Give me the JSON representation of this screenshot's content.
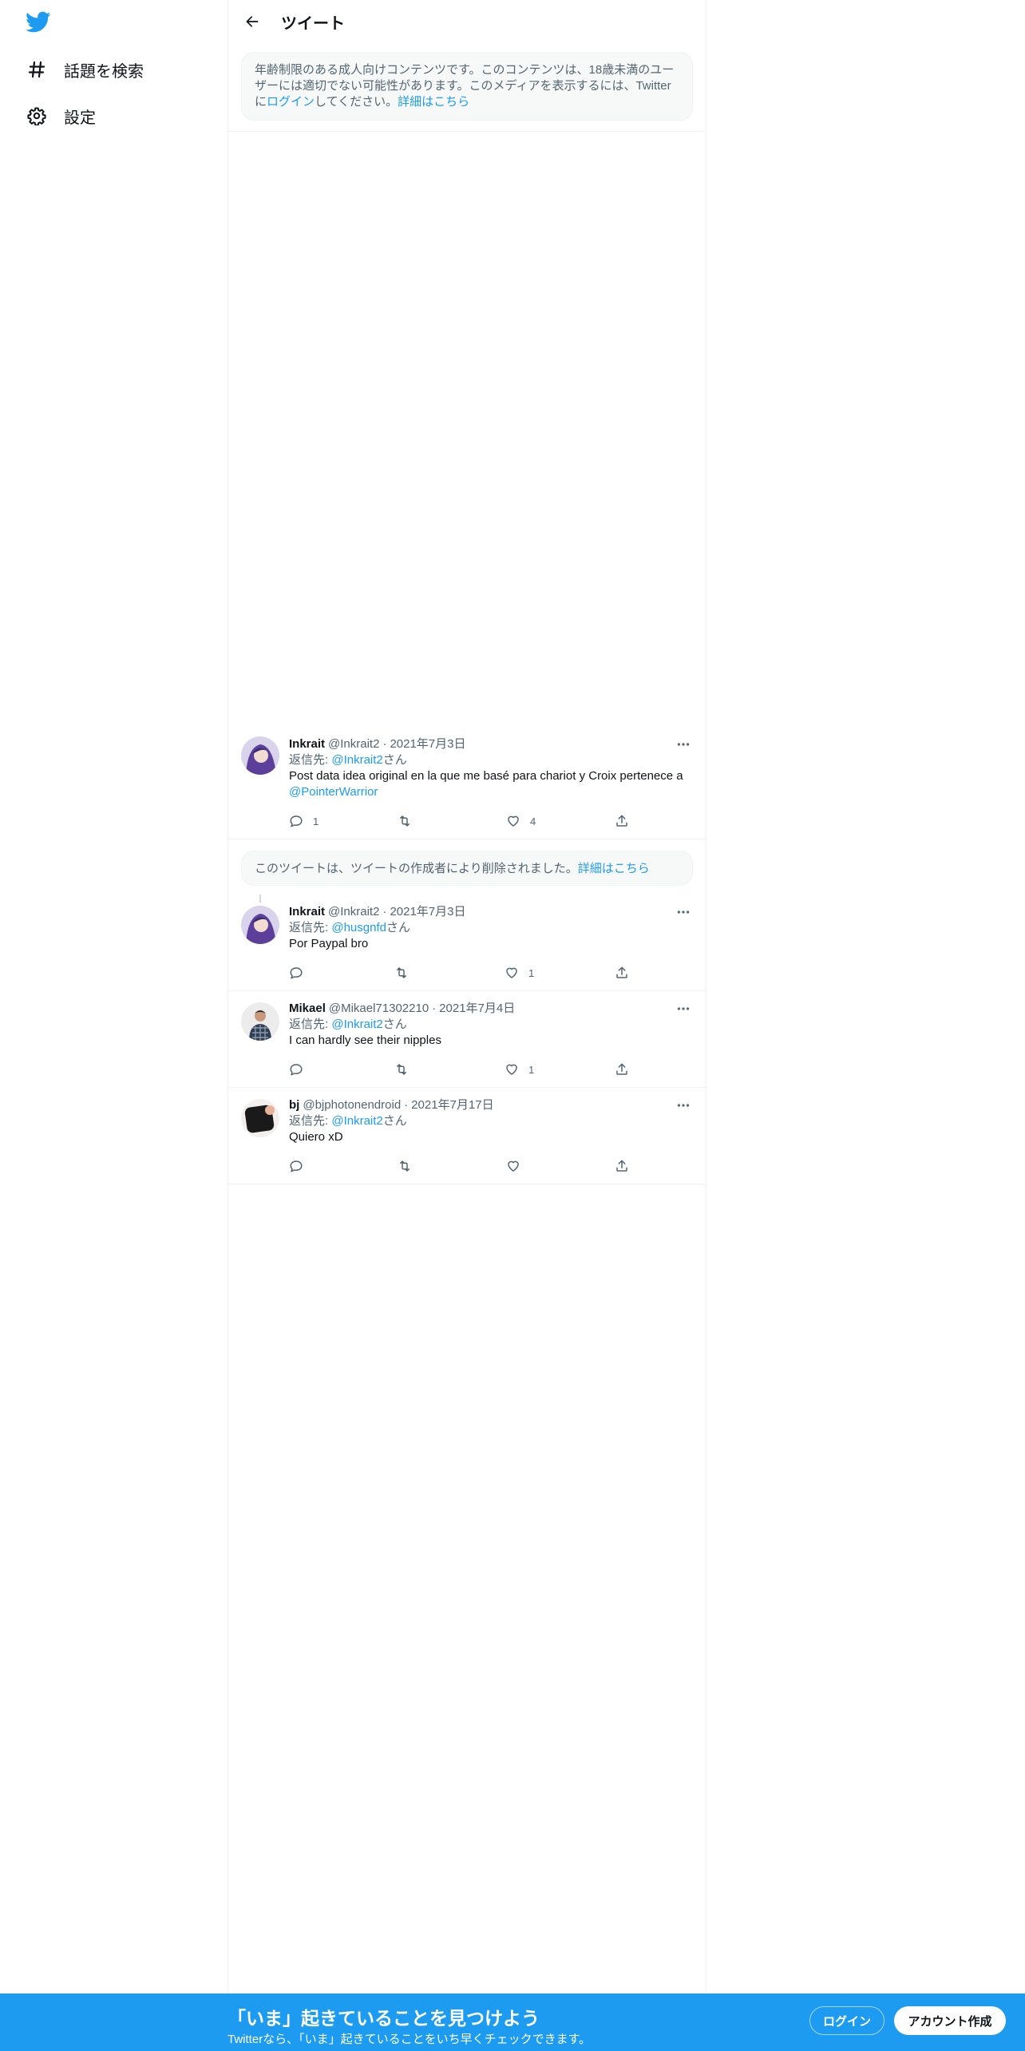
{
  "sidebar": {
    "items": [
      {
        "label": "話題を検索",
        "icon": "hashtag-icon"
      },
      {
        "label": "設定",
        "icon": "gear-icon"
      }
    ]
  },
  "header": {
    "title": "ツイート"
  },
  "sensitive_notice": {
    "text": "年齢制限のある成人向けコンテンツです。このコンテンツは、18歳未満のユーザーには適切でない可能性があります。このメディアを表示するには、Twitterに",
    "login_link": "ログイン",
    "text_after": "してください。",
    "learn_more": "詳細はこちら"
  },
  "deleted_notice": {
    "text": "このツイートは、ツイートの作成者により削除されました。",
    "learn_more": "詳細はこちら"
  },
  "reply_prefix": "返信先: ",
  "reply_suffix": "さん",
  "tweets": [
    {
      "name": "Inkrait",
      "handle": "@Inkrait2",
      "date": "2021年7月3日",
      "reply_to": "@Inkrait2",
      "text": "Post data idea original en la que me basé para chariot y Croix pertenece a ",
      "mention": "@PointerWarrior",
      "replies": "1",
      "retweets": "",
      "likes": "4"
    },
    {
      "name": "Inkrait",
      "handle": "@Inkrait2",
      "date": "2021年7月3日",
      "reply_to": "@husgnfd",
      "text": "Por Paypal bro",
      "replies": "",
      "retweets": "",
      "likes": "1"
    },
    {
      "name": "Mikael",
      "handle": "@Mikael71302210",
      "date": "2021年7月4日",
      "reply_to": "@Inkrait2",
      "text": "I can hardly see their nipples",
      "replies": "",
      "retweets": "",
      "likes": "1"
    },
    {
      "name": "bj",
      "handle": "@bjphotonendroid",
      "date": "2021年7月17日",
      "reply_to": "@Inkrait2",
      "text": "Quiero xD",
      "replies": "",
      "retweets": "",
      "likes": ""
    }
  ],
  "bottom_bar": {
    "title": "「いま」起きていることを見つけよう",
    "subtitle": "Twitterなら、「いま」起きていることをいち早くチェックできます。",
    "login": "ログイン",
    "signup": "アカウント作成"
  },
  "colors": {
    "accent": "#1d9bf0",
    "text": "#0f1419",
    "secondary": "#536471"
  }
}
